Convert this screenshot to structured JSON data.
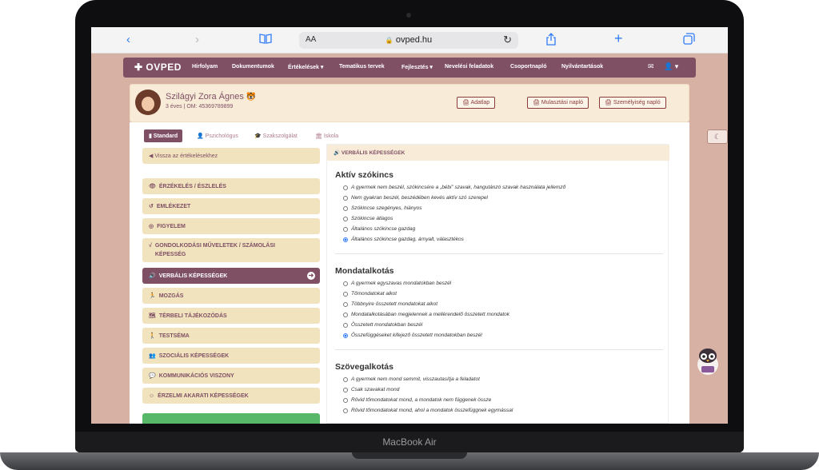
{
  "device": {
    "label": "MacBook Air"
  },
  "browser": {
    "aa_label": "AA",
    "url": "ovped.hu",
    "lock_glyph": "🔒"
  },
  "nav": {
    "logo": "OVPED",
    "items": [
      {
        "label": "Hírfolyam"
      },
      {
        "label": "Dokumentumok"
      },
      {
        "label": "Értékelések ▾"
      },
      {
        "label": "Tematikus tervek"
      },
      {
        "label": "Fejlesztés ▾"
      },
      {
        "label": "Nevelési feladatok"
      },
      {
        "label": "Csoportnapló"
      },
      {
        "label": "Nyilvántartások"
      }
    ],
    "mail_glyph": "✉",
    "user_glyph": "👤 ▾"
  },
  "profile": {
    "name": "Szilágyi Zora Ágnes",
    "sub": "3 éves | OM: 45369789899",
    "buttons": [
      {
        "label": "🖨 Adatlap"
      },
      {
        "label": "🖨 Mulasztási napló"
      },
      {
        "label": "🖨 Személyiség napló"
      }
    ]
  },
  "tabs": [
    {
      "label": "▮ Standard",
      "active": true
    },
    {
      "label": "👤 Pszichológus"
    },
    {
      "label": "🎓 Szakszolgálat"
    },
    {
      "label": "🏛 Iskola"
    }
  ],
  "sidebar": {
    "back": "◀ Vissza az értékelésekhez",
    "items": [
      {
        "icon": "👁",
        "label": "ÉRZÉKELÉS / ÉSZLELÉS"
      },
      {
        "icon": "↺",
        "label": "EMLÉKEZET"
      },
      {
        "icon": "◎",
        "label": "FIGYELEM"
      },
      {
        "icon": "√",
        "label": "GONDOLKODÁSI MŰVELETEK / SZÁMOLÁSI KÉPESSÉG"
      },
      {
        "icon": "🔊",
        "label": "VERBÁLIS KÉPESSÉGEK",
        "active": true
      },
      {
        "icon": "🏃",
        "label": "MOZGÁS"
      },
      {
        "icon": "🗺",
        "label": "TÉRBELI TÁJÉKOZÓDÁS"
      },
      {
        "icon": "🚶",
        "label": "TESTSÉMA"
      },
      {
        "icon": "👥",
        "label": "SZOCIÁLIS KÉPESSÉGEK"
      },
      {
        "icon": "💬",
        "label": "KOMMUNIKÁCIÓS VISZONY"
      },
      {
        "icon": "☺",
        "label": "ÉRZELMI AKARATI KÉPESSÉGEK"
      }
    ]
  },
  "main": {
    "header": "🔊 VERBÁLIS KÉPESSÉGEK",
    "sections": [
      {
        "title": "Aktív szókincs",
        "options": [
          "A gyermek nem beszél, szókincsére a „bébi” szavak, hangutánzó szavak használata jellemző",
          "Nem gyakran beszél, beszédében kevés aktív szó szerepel",
          "Szókincse szegényes, hiányos",
          "Szókincse átlagos",
          "Általános szókincse gazdag",
          "Általános szókincse gazdag, árnyalt, választékos"
        ],
        "selected": 5
      },
      {
        "title": "Mondatalkotás",
        "options": [
          "A gyermek egyszavas mondatokban beszél",
          "Tőmondatokat alkot",
          "Többnyire összetett mondatokat alkot",
          "Mondatalkotásában megjelennek a mellérendelő összetett mondatok",
          "Összetett mondatokban beszél",
          "Összefüggéseket kifejező összetett mondatokban beszél"
        ],
        "selected": 5
      },
      {
        "title": "Szövegalkotás",
        "options": [
          "A gyermek nem mond semmit, visszautasítja a feladatot",
          "Csak szavakat mond",
          "Rövid tőmondatokat mond, a mondatok nem függenek össze",
          "Rövid tőmondatokat mond, ahol a mondatok összefüggnek egymással"
        ],
        "selected": -1
      }
    ]
  },
  "side": {
    "moon_glyph": "☾"
  }
}
